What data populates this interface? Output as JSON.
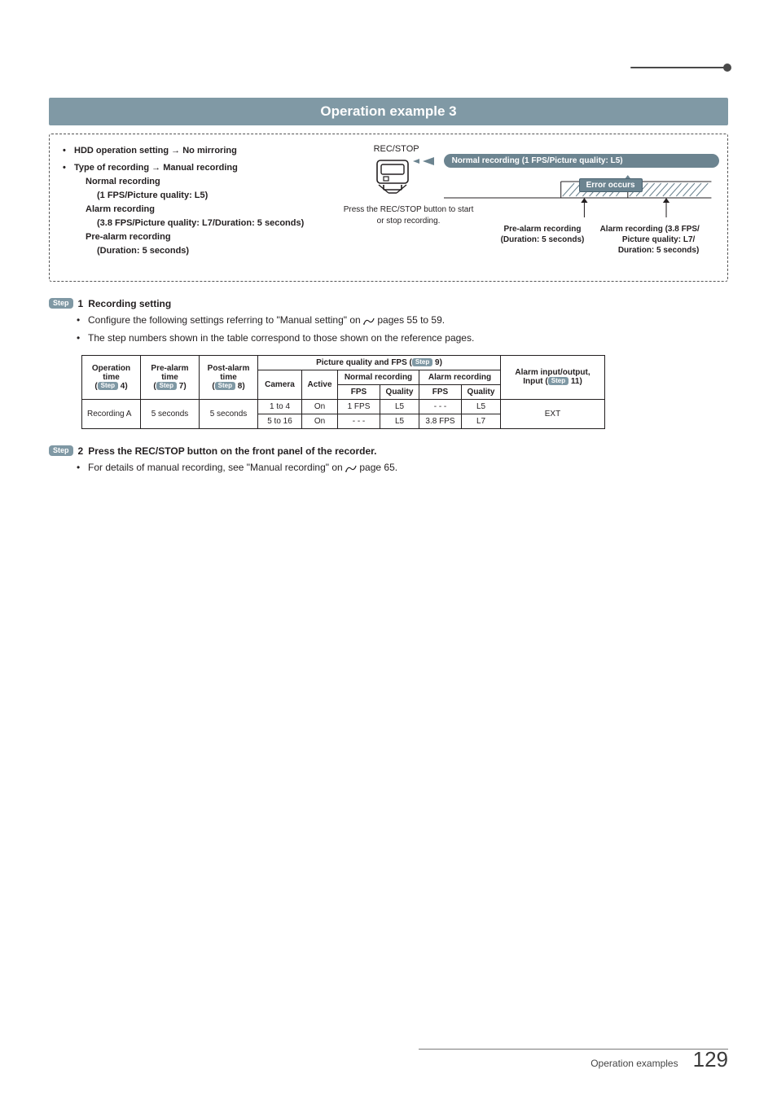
{
  "section_title": "Operation example 3",
  "example": {
    "bullets": [
      {
        "head": "HDD operation setting → No mirroring"
      },
      {
        "head": "Type of recording → Manual recording",
        "subs": [
          {
            "label": "Normal recording",
            "detail": "(1 FPS/Picture quality: L5)"
          },
          {
            "label": "Alarm recording",
            "detail": "(3.8 FPS/Picture quality: L7/Duration: 5 seconds)"
          },
          {
            "label": "Pre-alarm recording",
            "detail": "(Duration: 5 seconds)"
          }
        ]
      }
    ],
    "recstop_label": "REC/STOP",
    "press_text": "Press the REC/STOP button to start or stop recording.",
    "bubble": "Normal recording (1 FPS/Picture quality: L5)",
    "error_label": "Error occurs",
    "prealarm_caption_l1": "Pre-alarm recording",
    "prealarm_caption_l2": "(Duration: 5 seconds)",
    "alarmrec_caption_l1": "Alarm recording (3.8 FPS/",
    "alarmrec_caption_l2": "Picture quality: L7/",
    "alarmrec_caption_l3": "Duration: 5 seconds)"
  },
  "step1": {
    "pill": "Step",
    "num": "1",
    "title": "Recording setting",
    "bullets": [
      "Configure the following settings referring to \"Manual setting\" on ☞ pages 55 to 59.",
      "The step numbers shown in the table correspond to those shown on the reference pages."
    ]
  },
  "table": {
    "pq_header": "Picture quality and FPS (",
    "pq_header_num": " 9)",
    "io_header_l1": "Alarm input/output,",
    "io_header_l2": "Input (",
    "io_header_num": " 11)",
    "op_head_l1": "Operation",
    "op_head_l2": "time",
    "op_head_l3": "(",
    "op_head_num": " 4)",
    "pre_head_l1": "Pre-alarm",
    "pre_head_l2": "time",
    "pre_head_l3": "(",
    "pre_head_num": " 7)",
    "post_head_l1": "Post-alarm",
    "post_head_l2": "time",
    "post_head_l3": "(",
    "post_head_num": " 8)",
    "camera_head": "Camera",
    "active_head": "Active",
    "normal_head": "Normal recording",
    "alarm_head": "Alarm recording",
    "fps_head": "FPS",
    "quality_head": "Quality",
    "rows": [
      {
        "op": "Recording A",
        "pre": "5 seconds",
        "post": "5 seconds",
        "camera": "1 to 4",
        "active": "On",
        "nfps": "1 FPS",
        "nq": "L5",
        "afps": "- - -",
        "aq": "L5",
        "io": "EXT"
      },
      {
        "camera": "5 to 16",
        "active": "On",
        "nfps": "- - -",
        "nq": "L5",
        "afps": "3.8 FPS",
        "aq": "L7"
      }
    ]
  },
  "step2": {
    "pill": "Step",
    "num": "2",
    "title": "Press the REC/STOP button on the front panel of the recorder.",
    "bullets": [
      "For details of manual recording, see \"Manual recording\" on ☞ page 65."
    ]
  },
  "footer": {
    "label": "Operation examples",
    "page": "129"
  },
  "ui": {
    "step_label": "Step"
  }
}
